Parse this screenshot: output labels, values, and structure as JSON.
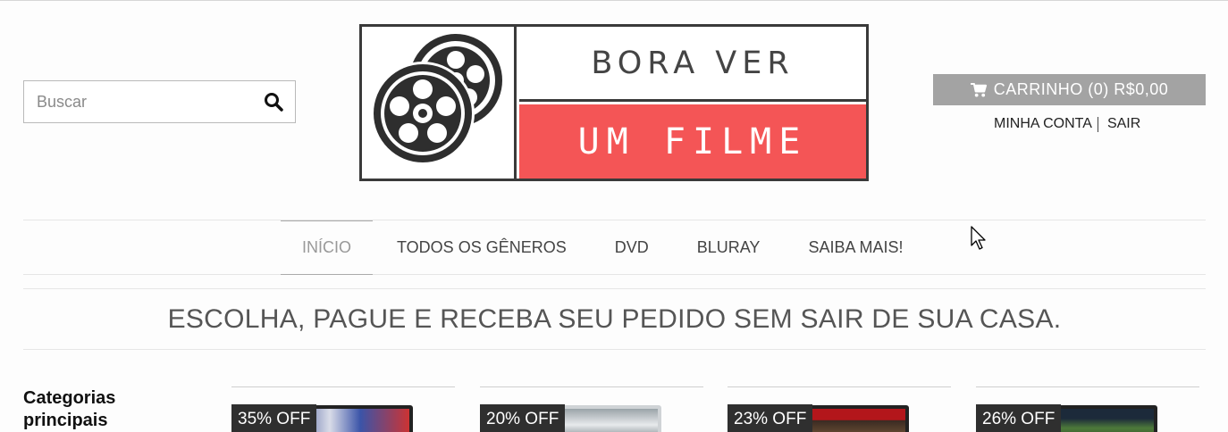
{
  "search": {
    "placeholder": "Buscar",
    "icon": "search-icon"
  },
  "logo": {
    "line1": "BORA VER",
    "line2": "UM FILME",
    "accent": "#f45556"
  },
  "cart": {
    "label": "CARRINHO (0) R$0,00",
    "icon": "cart-icon",
    "bg": "#a3a3a3"
  },
  "account": {
    "my_account": "MINHA CONTA",
    "logout": "SAIR"
  },
  "nav": {
    "items": [
      {
        "label": "INÍCIO",
        "active": true
      },
      {
        "label": "TODOS OS GÊNEROS"
      },
      {
        "label": "DVD"
      },
      {
        "label": "BLURAY"
      },
      {
        "label": "SAIBA MAIS!"
      }
    ]
  },
  "banner": {
    "text": "ESCOLHA, PAGUE E RECEBA SEU PEDIDO SEM SAIR DE SUA CASA."
  },
  "sidebar": {
    "title_line1": "Categorias",
    "title_line2": "principais"
  },
  "products": [
    {
      "discount": "35% OFF"
    },
    {
      "discount": "20% OFF"
    },
    {
      "discount": "23% OFF"
    },
    {
      "discount": "26% OFF"
    }
  ]
}
